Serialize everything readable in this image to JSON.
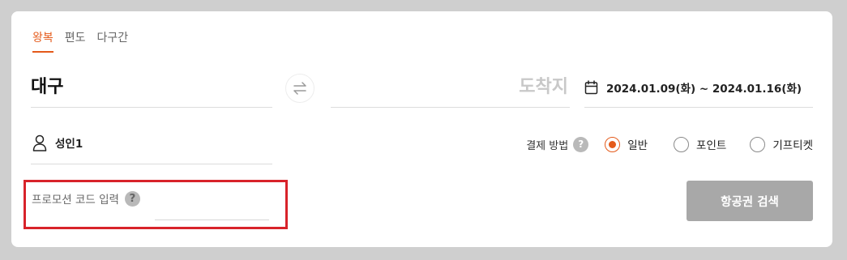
{
  "tabs": [
    {
      "label": "왕복",
      "active": true
    },
    {
      "label": "편도",
      "active": false
    },
    {
      "label": "다구간",
      "active": false
    }
  ],
  "route": {
    "origin": "대구",
    "destination_placeholder": "도착지",
    "swap_icon": "swap-arrows-icon"
  },
  "dates": {
    "icon": "calendar-icon",
    "value": "2024.01.09(화) ~ 2024.01.16(화)"
  },
  "passengers": {
    "icon": "person-icon",
    "value": "성인1"
  },
  "payment": {
    "label": "결제 방법",
    "help": "?",
    "options": [
      {
        "label": "일반",
        "selected": true
      },
      {
        "label": "포인트",
        "selected": false
      },
      {
        "label": "기프티켓",
        "selected": false
      }
    ]
  },
  "promo": {
    "label": "프로모션 코드 입력",
    "help": "?",
    "value": ""
  },
  "search_button": "항공권 검색",
  "colors": {
    "accent": "#e45a1a",
    "highlight_border": "#d8232a",
    "button_disabled": "#a8a8a8"
  }
}
